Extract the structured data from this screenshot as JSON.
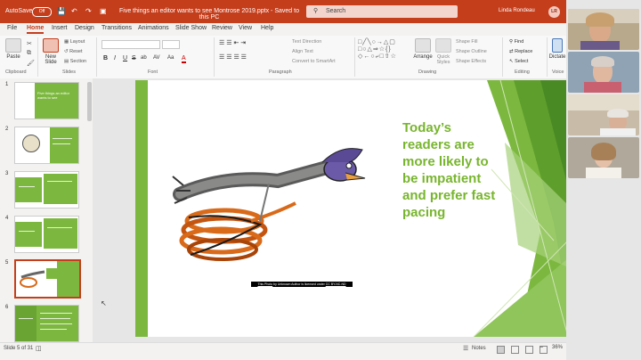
{
  "titlebar": {
    "autosave_label": "AutoSave",
    "autosave_state": "Off",
    "document_title": "Five things an editor wants to see Montrose 2019.pptx  -  Saved to this PC",
    "search_placeholder": "Search",
    "user_name": "Linda Rondeau",
    "user_initials": "LR",
    "brand_color": "#c43e1c"
  },
  "tabs": [
    "File",
    "Home",
    "Insert",
    "Design",
    "Transitions",
    "Animations",
    "Slide Show",
    "Review",
    "View",
    "Help"
  ],
  "active_tab": "Home",
  "ribbon": {
    "clipboard": {
      "paste": "Paste",
      "group": "Clipboard"
    },
    "slides": {
      "new_slide": "New Slide",
      "layout": "Layout",
      "reset": "Reset",
      "section": "Section",
      "group": "Slides"
    },
    "font": {
      "group": "Font",
      "format_buttons": [
        "B",
        "I",
        "U",
        "S",
        "ab",
        "AV",
        "Aa",
        "A"
      ]
    },
    "paragraph": {
      "text_direction": "Text Direction",
      "align_text": "Align Text",
      "convert_smartart": "Convert to SmartArt",
      "group": "Paragraph"
    },
    "drawing": {
      "arrange": "Arrange",
      "quick_styles": "Quick Styles",
      "shape_fill": "Shape Fill",
      "shape_outline": "Shape Outline",
      "shape_effects": "Shape Effects",
      "group": "Drawing"
    },
    "editing": {
      "find": "Find",
      "replace": "Replace",
      "select": "Select",
      "group": "Editing"
    },
    "voice": {
      "dictate": "Dictate",
      "group": "Voice"
    }
  },
  "thumbnails": [
    {
      "num": "1",
      "text": "Five things an editor wants to see"
    },
    {
      "num": "2",
      "text": ""
    },
    {
      "num": "3",
      "text": ""
    },
    {
      "num": "4",
      "text": ""
    },
    {
      "num": "5",
      "text": ""
    },
    {
      "num": "6",
      "text": ""
    }
  ],
  "selected_slide": 5,
  "slide": {
    "title": "Today’s readers are more likely to be impatient and prefer fast pacing",
    "caption_link": "This Photo",
    "caption_mid": " by Unknown Author is licensed under ",
    "caption_license": "CC BY-NC-ND",
    "accent_green": "#78b52e"
  },
  "status": {
    "slide_count": "Slide 5 of 31",
    "notes": "Notes",
    "zoom": "36%"
  }
}
